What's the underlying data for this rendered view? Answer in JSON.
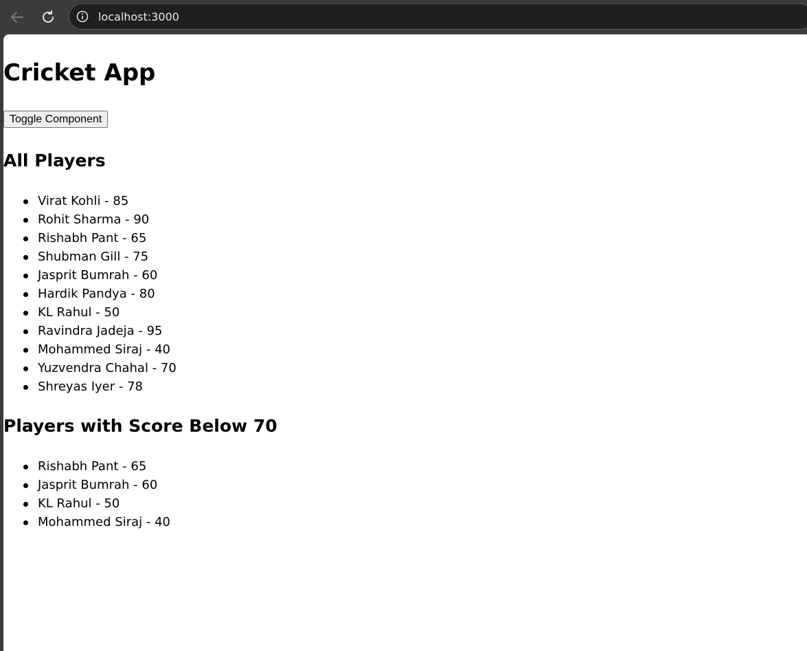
{
  "browser": {
    "url": "localhost:3000"
  },
  "app": {
    "title": "Cricket App",
    "toggle_label": "Toggle Component"
  },
  "all_players": {
    "heading": "All Players",
    "items": [
      "Virat Kohli - 85",
      "Rohit Sharma - 90",
      "Rishabh Pant - 65",
      "Shubman Gill - 75",
      "Jasprit Bumrah - 60",
      "Hardik Pandya - 80",
      "KL Rahul - 50",
      "Ravindra Jadeja - 95",
      "Mohammed Siraj - 40",
      "Yuzvendra Chahal - 70",
      "Shreyas Iyer - 78"
    ]
  },
  "below_70": {
    "heading": "Players with Score Below 70",
    "items": [
      "Rishabh Pant - 65",
      "Jasprit Bumrah - 60",
      "KL Rahul - 50",
      "Mohammed Siraj - 40"
    ]
  }
}
